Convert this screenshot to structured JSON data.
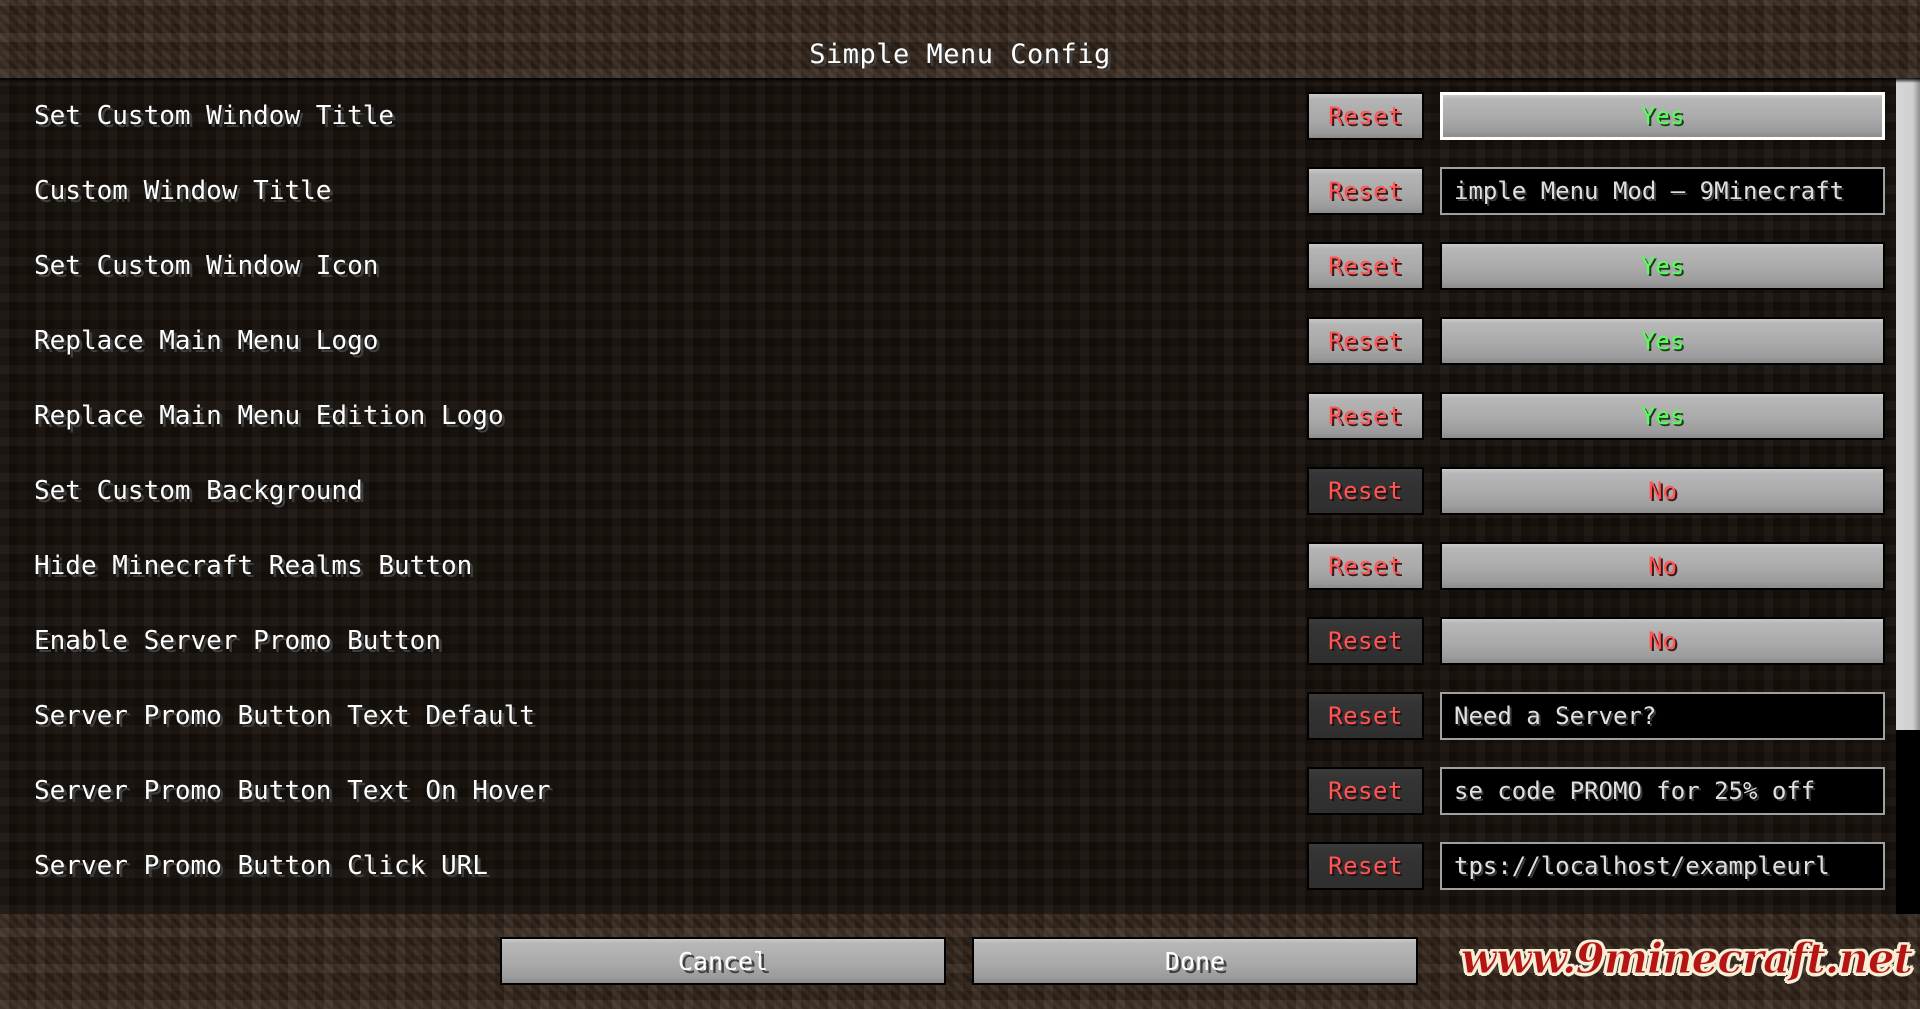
{
  "window": {
    "title": "Simple Menu Config"
  },
  "colors": {
    "yes": "#55ff55",
    "no": "#ff5555",
    "reset": "#ff5555",
    "label": "#ffffff",
    "watermark": "#b51414",
    "background_dirt": "#33251a",
    "list_dirt": "#16100b"
  },
  "list": {
    "rows": [
      {
        "label": "Set Custom Window Title",
        "reset_label": "Reset",
        "reset_enabled": true,
        "widget": "toggle",
        "value": "Yes",
        "focused": true
      },
      {
        "label": "Custom Window Title",
        "reset_label": "Reset",
        "reset_enabled": true,
        "widget": "text",
        "value": "imple Menu Mod — 9Minecraft",
        "focused": false
      },
      {
        "label": "Set Custom Window Icon",
        "reset_label": "Reset",
        "reset_enabled": true,
        "widget": "toggle",
        "value": "Yes",
        "focused": false
      },
      {
        "label": "Replace Main Menu Logo",
        "reset_label": "Reset",
        "reset_enabled": true,
        "widget": "toggle",
        "value": "Yes",
        "focused": false
      },
      {
        "label": "Replace Main Menu Edition Logo",
        "reset_label": "Reset",
        "reset_enabled": true,
        "widget": "toggle",
        "value": "Yes",
        "focused": false
      },
      {
        "label": "Set Custom Background",
        "reset_label": "Reset",
        "reset_enabled": false,
        "widget": "toggle",
        "value": "No",
        "focused": false
      },
      {
        "label": "Hide Minecraft Realms Button",
        "reset_label": "Reset",
        "reset_enabled": true,
        "widget": "toggle",
        "value": "No",
        "focused": false
      },
      {
        "label": "Enable Server Promo Button",
        "reset_label": "Reset",
        "reset_enabled": false,
        "widget": "toggle",
        "value": "No",
        "focused": false
      },
      {
        "label": "Server Promo Button Text Default",
        "reset_label": "Reset",
        "reset_enabled": false,
        "widget": "text",
        "value": "Need a Server?",
        "focused": false
      },
      {
        "label": "Server Promo Button Text On Hover",
        "reset_label": "Reset",
        "reset_enabled": false,
        "widget": "text",
        "value": "se code PROMO for 25% off",
        "focused": false
      },
      {
        "label": "Server Promo Button Click URL",
        "reset_label": "Reset",
        "reset_enabled": false,
        "widget": "text",
        "value": "tps://localhost/exampleurl",
        "focused": false
      }
    ]
  },
  "scrollbar": {
    "thumb_percent": 78
  },
  "footer": {
    "cancel_label": "Cancel",
    "done_label": "Done",
    "watermark": "www.9minecraft.net"
  }
}
